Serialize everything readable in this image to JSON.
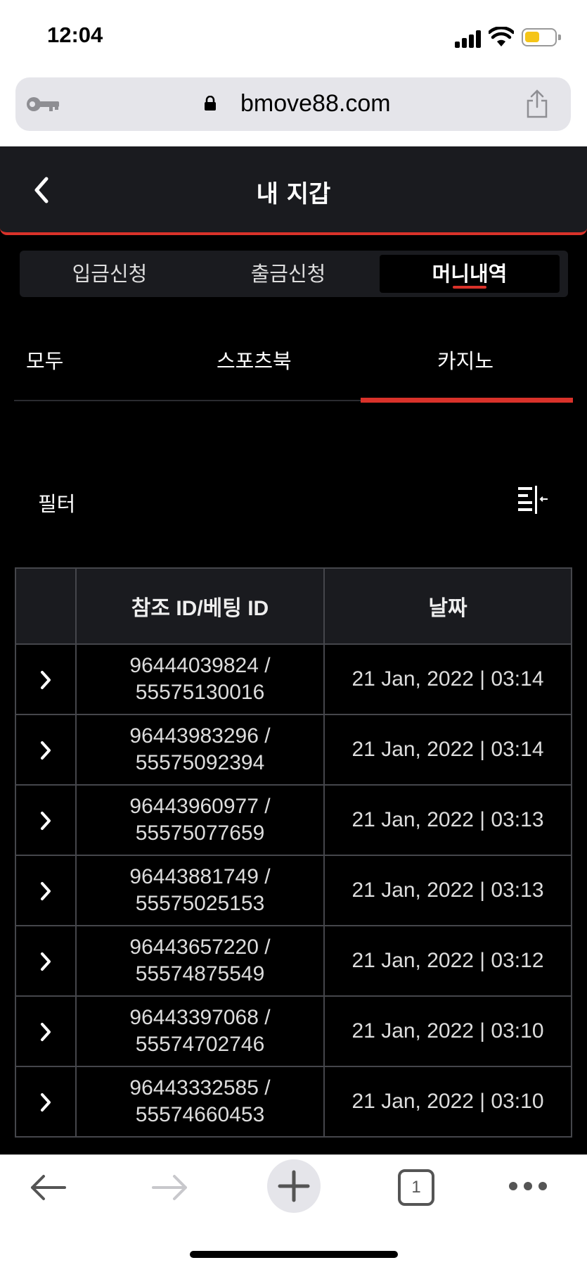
{
  "status": {
    "time": "12:04"
  },
  "browser": {
    "url": "bmove88.com"
  },
  "header": {
    "title": "내 지갑"
  },
  "main_tabs": [
    {
      "label": "입금신청",
      "active": false
    },
    {
      "label": "출금신청",
      "active": false
    },
    {
      "label": "머니내역",
      "active": true
    }
  ],
  "sub_tabs": [
    {
      "label": "모두",
      "active": false
    },
    {
      "label": "스포츠북",
      "active": false
    },
    {
      "label": "카지노",
      "active": true
    }
  ],
  "filter": {
    "label": "필터"
  },
  "table": {
    "headers": [
      "참조 ID/베팅 ID",
      "날짜"
    ],
    "rows": [
      {
        "ref_id": "96444039824 /",
        "bet_id": "55575130016",
        "date": "21 Jan, 2022 | 03:14"
      },
      {
        "ref_id": "96443983296 /",
        "bet_id": "55575092394",
        "date": "21 Jan, 2022 | 03:14"
      },
      {
        "ref_id": "96443960977 /",
        "bet_id": "55575077659",
        "date": "21 Jan, 2022 | 03:13"
      },
      {
        "ref_id": "96443881749 /",
        "bet_id": "55575025153",
        "date": "21 Jan, 2022 | 03:13"
      },
      {
        "ref_id": "96443657220 /",
        "bet_id": "55574875549",
        "date": "21 Jan, 2022 | 03:12"
      },
      {
        "ref_id": "96443397068 /",
        "bet_id": "55574702746",
        "date": "21 Jan, 2022 | 03:10"
      },
      {
        "ref_id": "96443332585 /",
        "bet_id": "55574660453",
        "date": "21 Jan, 2022 | 03:10"
      }
    ]
  },
  "toolbar": {
    "tab_count": "1"
  },
  "colors": {
    "accent": "#d9322a",
    "panel": "#1a1b1f",
    "background": "#000000"
  }
}
